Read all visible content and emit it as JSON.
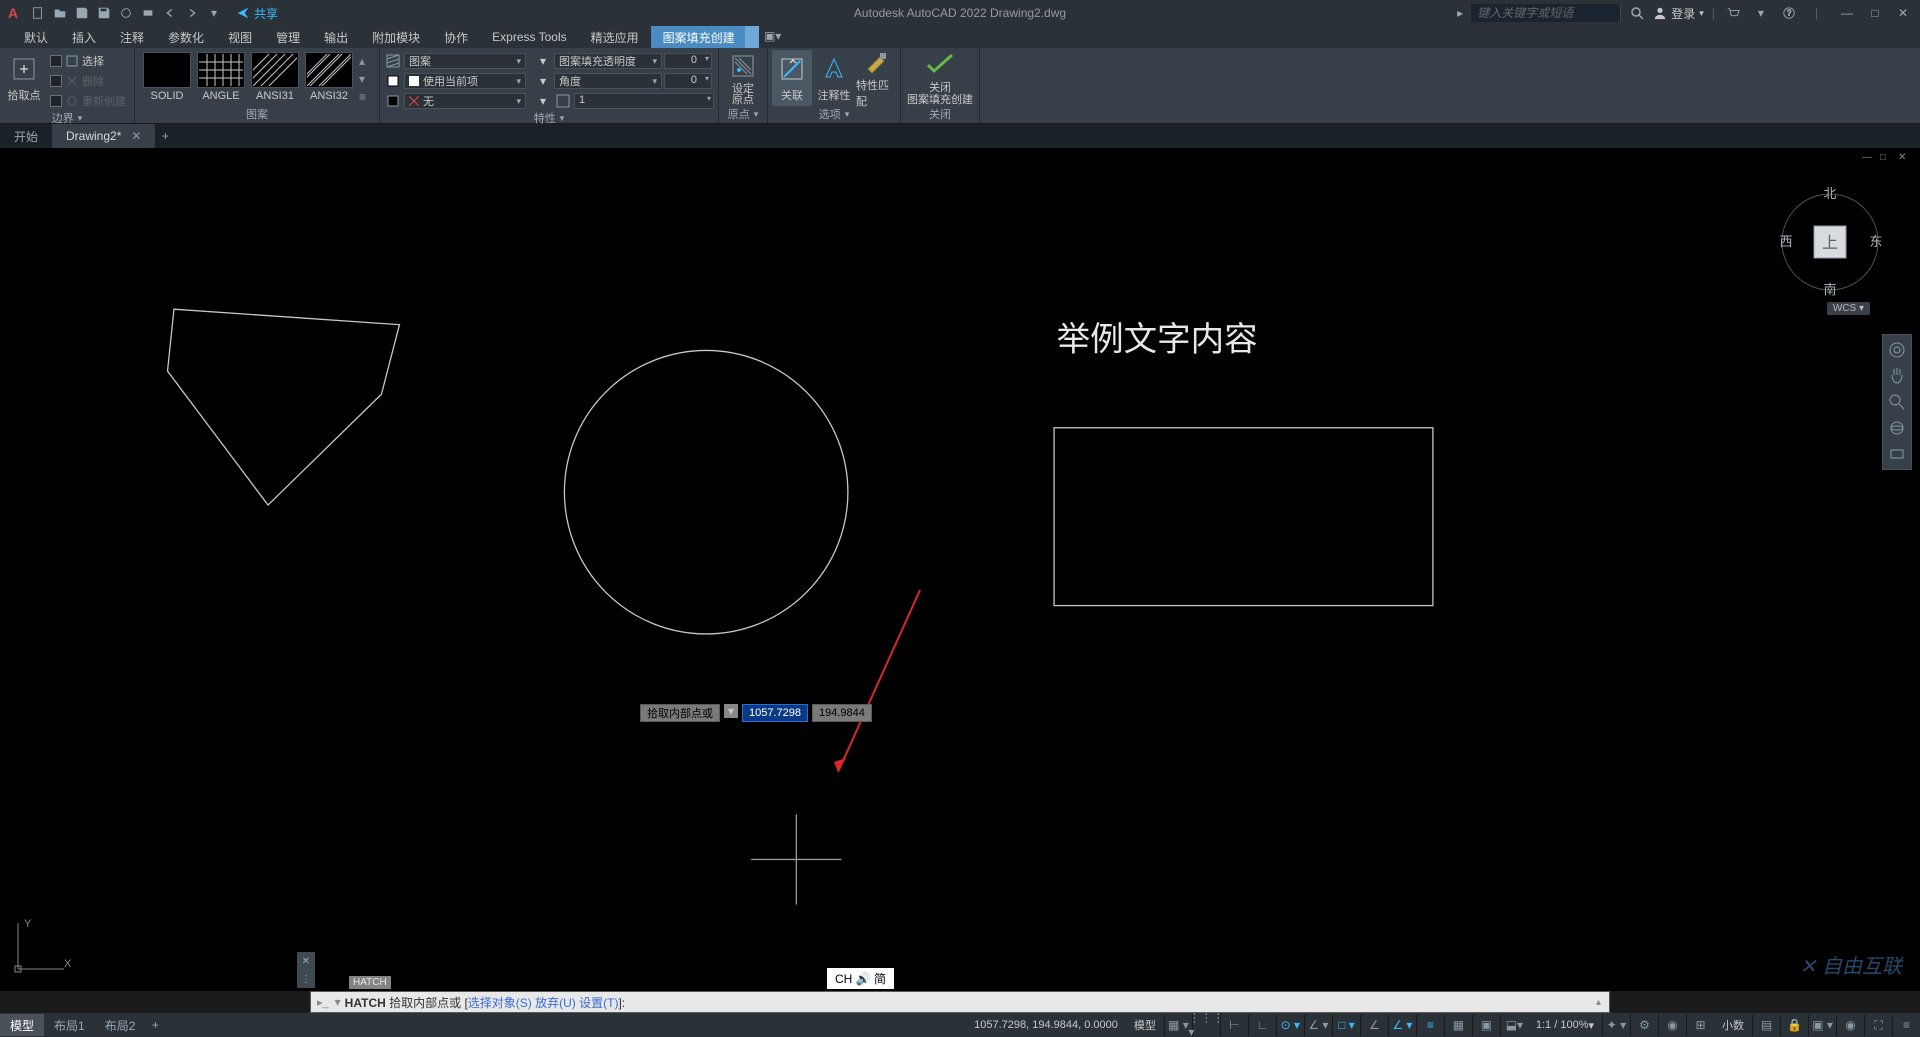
{
  "app": {
    "title": "Autodesk AutoCAD 2022    Drawing2.dwg",
    "search_placeholder": "键入关键字或短语",
    "login": "登录",
    "share": "共享"
  },
  "menu": {
    "tabs": [
      "默认",
      "插入",
      "注释",
      "参数化",
      "视图",
      "管理",
      "输出",
      "附加模块",
      "协作",
      "Express Tools",
      "精选应用",
      "图案填充创建"
    ],
    "active": 11
  },
  "ribbon": {
    "panel_boundary": {
      "title": "边界",
      "pick": "拾取点",
      "select": "选择",
      "delete": "删除",
      "recreate": "重新创建"
    },
    "panel_pattern": {
      "title": "图案",
      "solid": "SOLID",
      "angle": "ANGLE",
      "ansi31": "ANSI31",
      "ansi32": "ANSI32"
    },
    "panel_props": {
      "title": "特性",
      "pattern": "图案",
      "usecurrent": "使用当前项",
      "none": "无",
      "transparency": "图案填充透明度",
      "angle": "角度",
      "scale": "1",
      "val0a": "0",
      "val0b": "0"
    },
    "panel_origin": {
      "title": "原点",
      "setorigin": "设定\n原点"
    },
    "panel_options": {
      "title": "选项",
      "assoc": "关联",
      "annot": "注释性",
      "matchprop": "特性匹配"
    },
    "panel_close": {
      "title": "关闭",
      "close": "关闭\n图案填充创建"
    }
  },
  "doctabs": {
    "start": "开始",
    "drawing": "Drawing2*"
  },
  "viewcube": {
    "n": "北",
    "s": "南",
    "e": "东",
    "w": "西",
    "top": "上",
    "wcs": "WCS"
  },
  "canvas_text": "举例文字内容",
  "dyn": {
    "prompt": "拾取内部点或",
    "x": "1057.7298",
    "y": "194.9844"
  },
  "cmd": {
    "badge": "HATCH",
    "prefix": "HATCH",
    "prompt": "拾取内部点或 [",
    "opts": "选择对象(S) 放弃(U) 设置(T)",
    "suffix": "]:"
  },
  "ime": "CH 🔊 简",
  "status": {
    "layouts": [
      "模型",
      "布局1",
      "布局2"
    ],
    "coords": "1057.7298, 194.9844, 0.0000",
    "model": "模型",
    "scale": "1:1 / 100%",
    "decimal": "小数"
  },
  "watermark": "自由互联"
}
